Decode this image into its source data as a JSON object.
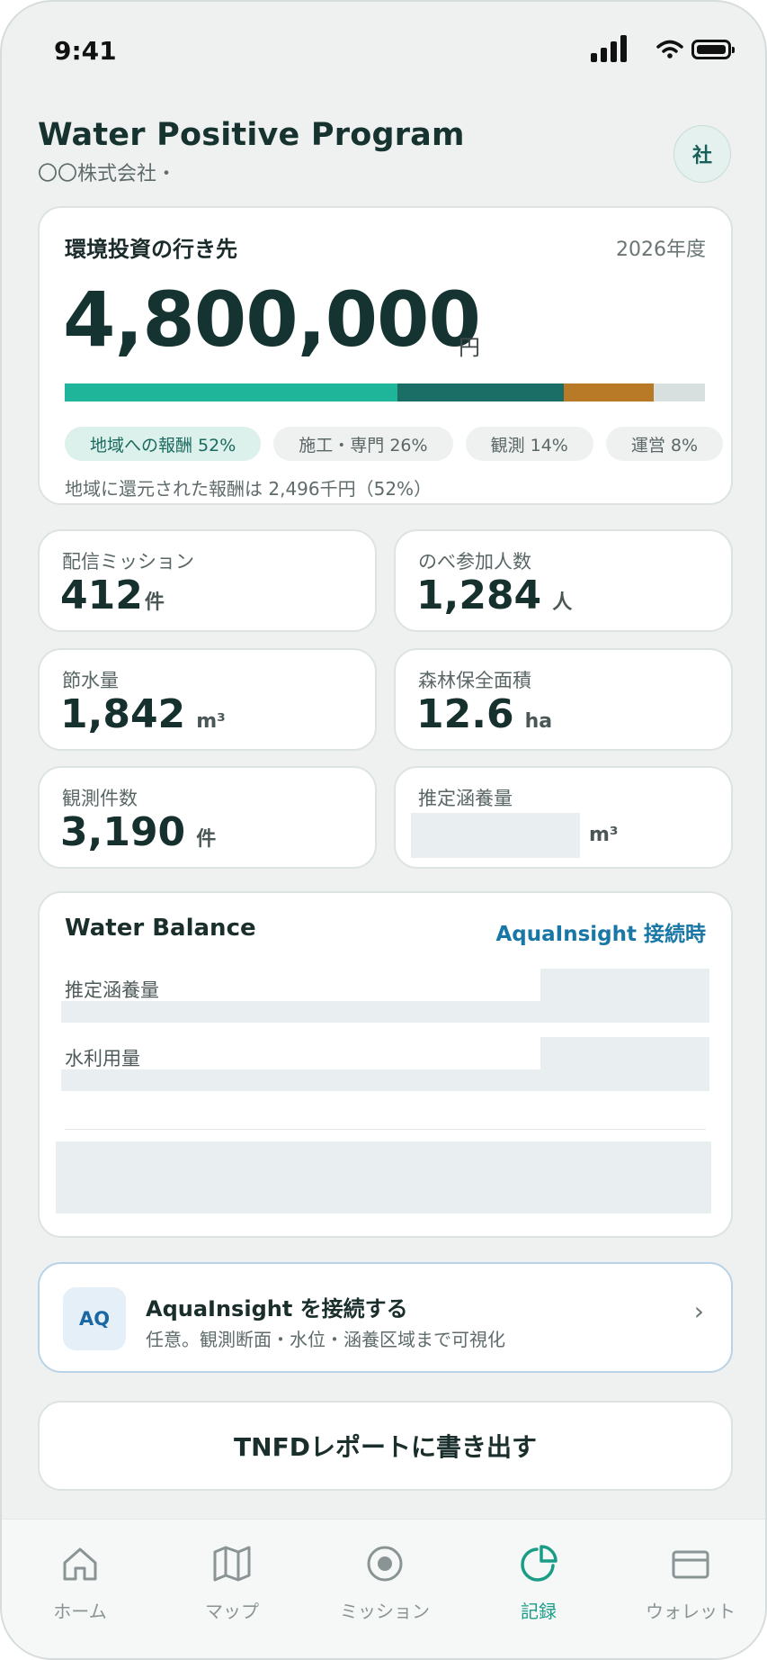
{
  "status_bar": {
    "time": "9:41"
  },
  "header": {
    "title": "Water Positive Program",
    "subtitle": "〇〇株式会社・",
    "avatar": "社"
  },
  "investment": {
    "label": "環境投資の行き先",
    "year": "2026年度",
    "amount": "4,800,000",
    "unit": "円",
    "allocation_percent": [
      52,
      26,
      14,
      8
    ],
    "colors": [
      "#1eb59a",
      "#1b6e66",
      "#b97a28",
      "#d8e0df"
    ],
    "chips": [
      "地域への報酬 52%",
      "施工・専門 26%",
      "観測 14%",
      "運営 8%"
    ],
    "note": "地域に還元された報酬は 2,496千円（52%）"
  },
  "stats": [
    {
      "label": "配信ミッション",
      "value": "412",
      "unit": "件"
    },
    {
      "label": "のべ参加人数",
      "value": "1,284",
      "unit": "人"
    },
    {
      "label": "節水量",
      "value": "1,842",
      "unit": "m³"
    },
    {
      "label": "森林保全面積",
      "value": "12.6",
      "unit": "ha"
    },
    {
      "label": "観測件数",
      "value": "3,190",
      "unit": "件"
    },
    {
      "label": "推定涵養量",
      "value": "",
      "unit": "m³"
    }
  ],
  "water_balance": {
    "title": "Water Balance",
    "link": "AquaInsight 接続時",
    "rows": [
      "推定涵養量",
      "水利用量"
    ]
  },
  "aqua": {
    "badge": "AQ",
    "title": "AquaInsight を接続する",
    "subtitle": "任意。観測断面・水位・涵養区域まで可視化",
    "chevron": "›"
  },
  "export_button": "TNFDレポートに書き出す",
  "tabs": [
    {
      "label": "ホーム",
      "icon": "home-icon"
    },
    {
      "label": "マップ",
      "icon": "map-icon"
    },
    {
      "label": "ミッション",
      "icon": "mission-target-icon"
    },
    {
      "label": "記録",
      "icon": "record-chart-icon",
      "active": true
    },
    {
      "label": "ウォレット",
      "icon": "wallet-icon"
    }
  ]
}
